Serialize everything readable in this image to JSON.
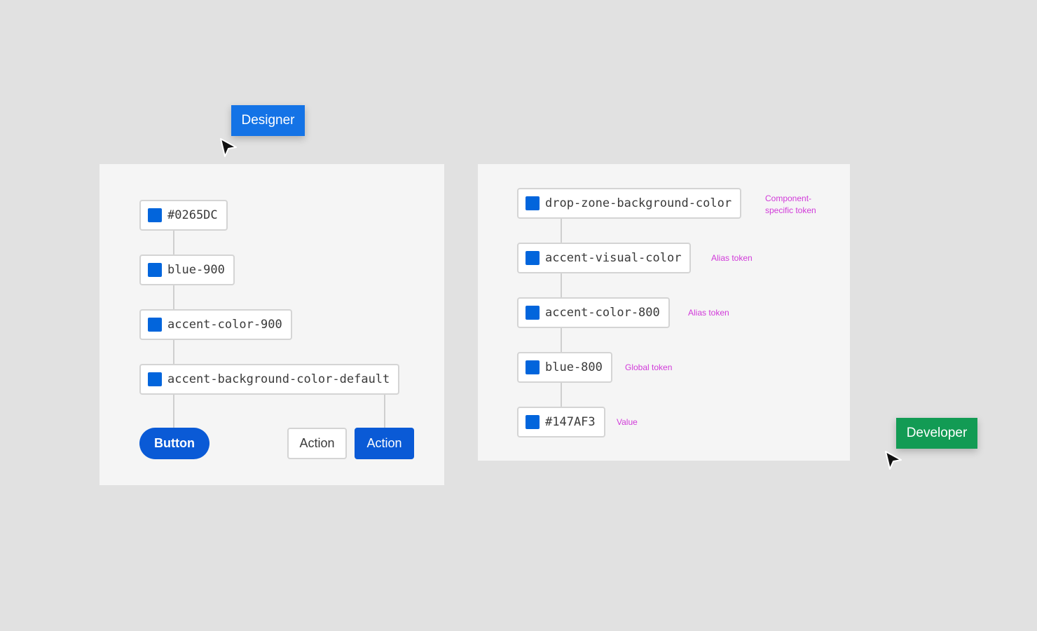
{
  "colors": {
    "background": "#e1e1e1",
    "panel": "#f5f5f5",
    "swatch": "#0265dc",
    "primary_button": "#0a5ad6",
    "designer_tag": "#1473e6",
    "developer_tag": "#129b54",
    "annotation": "#d13ad9"
  },
  "designer": {
    "label": "Designer",
    "tokens": [
      "#0265DC",
      "blue-900",
      "accent-color-900",
      "accent-background-color-default"
    ],
    "buttons": {
      "button": "Button",
      "action_secondary": "Action",
      "action_primary": "Action"
    }
  },
  "developer": {
    "label": "Developer",
    "tokens": [
      {
        "name": "drop-zone-background-color",
        "note": "Component-\nspecific token"
      },
      {
        "name": "accent-visual-color",
        "note": "Alias token"
      },
      {
        "name": "accent-color-800",
        "note": "Alias token"
      },
      {
        "name": "blue-800",
        "note": "Global token"
      },
      {
        "name": "#147AF3",
        "note": "Value"
      }
    ]
  },
  "icons": [
    "cursor-arrow-icon",
    "color-swatch-icon"
  ]
}
